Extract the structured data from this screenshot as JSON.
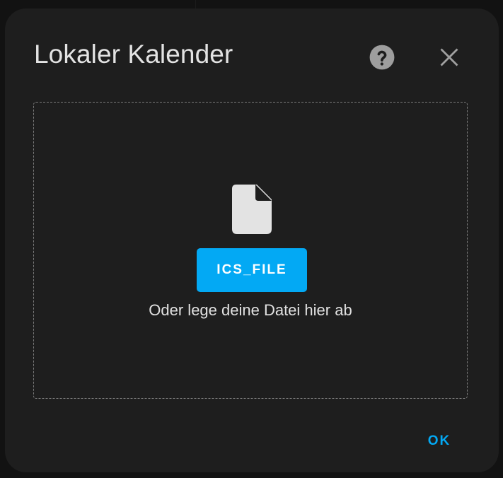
{
  "dialog": {
    "title": "Lokaler Kalender",
    "help_icon": "help-circle-icon",
    "close_icon": "close-icon"
  },
  "dropzone": {
    "file_icon": "file-icon",
    "upload_button_label": "ICS_FILE",
    "hint": "Oder lege deine Datei hier ab"
  },
  "actions": {
    "ok_label": "OK"
  },
  "colors": {
    "accent": "#03a9f4",
    "surface": "#1e1e1e",
    "text": "#e3e3e3",
    "icon": "#9e9e9e"
  }
}
